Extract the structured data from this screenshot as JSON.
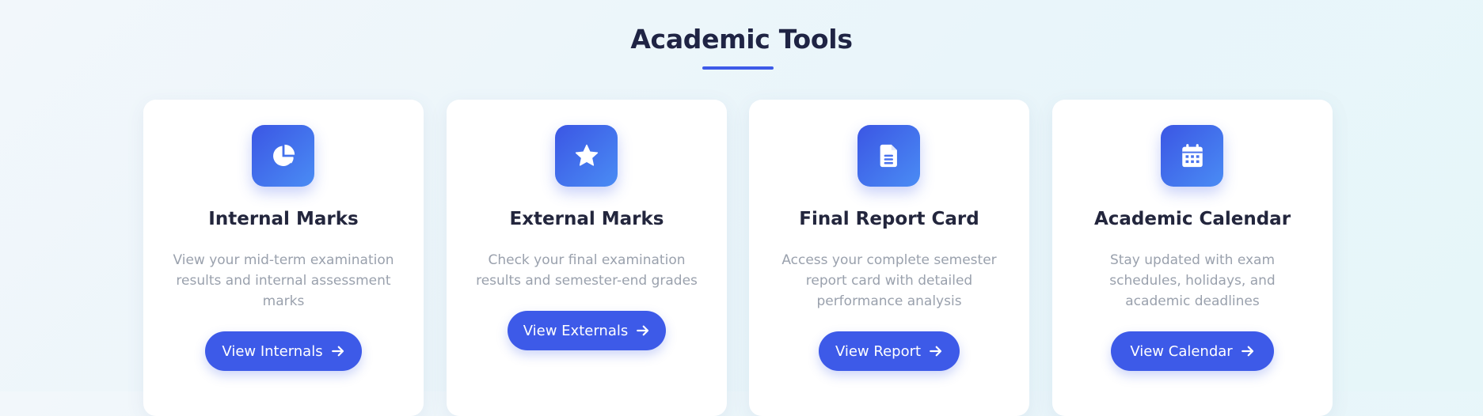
{
  "section": {
    "title": "Academic Tools"
  },
  "cards": [
    {
      "icon": "pie-chart-icon",
      "title": "Internal Marks",
      "description": "View your mid-term examination results and internal assessment marks",
      "button_label": "View Internals"
    },
    {
      "icon": "star-icon",
      "title": "External Marks",
      "description": "Check your final examination results and semester-end grades",
      "button_label": "View Externals"
    },
    {
      "icon": "document-icon",
      "title": "Final Report Card",
      "description": "Access your complete semester report card with detailed performance analysis",
      "button_label": "View Report"
    },
    {
      "icon": "calendar-icon",
      "title": "Academic Calendar",
      "description": "Stay updated with exam schedules, holidays, and academic deadlines",
      "button_label": "View Calendar"
    }
  ],
  "colors": {
    "accent": "#3d5ae8",
    "heading": "#1f2444",
    "muted_text": "#9aa1ad",
    "card_bg": "#ffffff"
  }
}
